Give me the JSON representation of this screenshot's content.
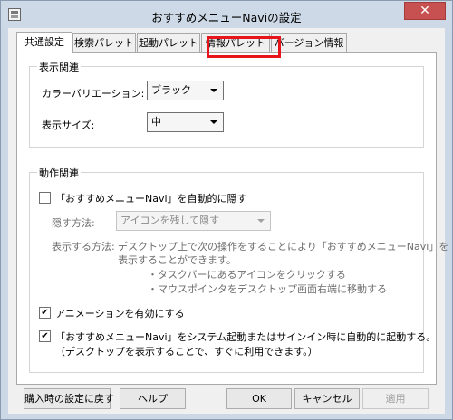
{
  "window": {
    "title": "おすすめメニューNaviの設定",
    "close_glyph": "✕"
  },
  "tabs": [
    {
      "label": "共通設定"
    },
    {
      "label": "検索パレット"
    },
    {
      "label": "起動パレット"
    },
    {
      "label": "情報パレット"
    },
    {
      "label": "バージョン情報"
    }
  ],
  "display": {
    "group_title": "表示関連",
    "color_label": "カラーバリエーション:",
    "color_value": "ブラック",
    "size_label": "表示サイズ:",
    "size_value": "中"
  },
  "behavior": {
    "group_title": "動作関連",
    "auto_hide_label": "「おすすめメニューNavi」を自動的に隠す",
    "auto_hide_checked": false,
    "hide_method_label": "隠す方法:",
    "hide_method_value": "アイコンを残して隠す",
    "show_method_label": "表示する方法:",
    "show_method_line1": "デスクトップ上で次の操作をすることにより「おすすめメニューNavi」を",
    "show_method_line2": "表示することができます。",
    "show_method_item1": "・タスクバーにあるアイコンをクリックする",
    "show_method_item2": "・マウスポインタをデスクトップ画面右端に移動する",
    "animation_label": "アニメーションを有効にする",
    "animation_checked": true,
    "startup_label_line1": "「おすすめメニューNavi」をシステム起動またはサインイン時に自動的に起動する。",
    "startup_label_line2": "（デスクトップを表示することで、すぐに利用できます。）",
    "startup_checked": true,
    "check_glyph": "✔"
  },
  "footer": {
    "reset_label": "購入時の設定に戻す",
    "help_label": "ヘルプ",
    "ok_label": "OK",
    "cancel_label": "キャンセル",
    "apply_label": "適用"
  }
}
